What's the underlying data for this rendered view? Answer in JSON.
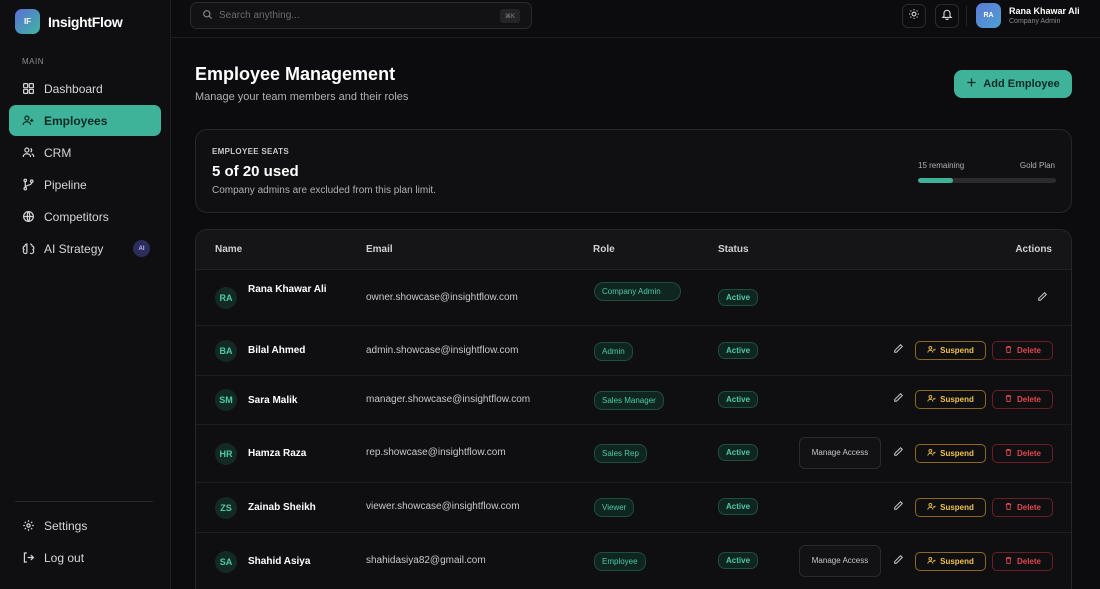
{
  "app": {
    "logo_initials": "IF",
    "name": "InsightFlow"
  },
  "sidebar": {
    "section_label": "MAIN",
    "items": [
      {
        "label": "Dashboard",
        "icon": "grid-icon",
        "active": false
      },
      {
        "label": "Employees",
        "icon": "users-icon",
        "active": true
      },
      {
        "label": "CRM",
        "icon": "people-icon",
        "active": false
      },
      {
        "label": "Pipeline",
        "icon": "branch-icon",
        "active": false
      },
      {
        "label": "Competitors",
        "icon": "globe-icon",
        "active": false
      },
      {
        "label": "AI Strategy",
        "icon": "brain-icon",
        "active": false,
        "badge": "AI"
      }
    ],
    "bottom": [
      {
        "label": "Settings",
        "icon": "gear-icon"
      },
      {
        "label": "Log out",
        "icon": "logout-icon"
      }
    ]
  },
  "topbar": {
    "search_placeholder": "Search anything...",
    "search_shortcut": "⌘K",
    "user": {
      "initials": "RA",
      "name": "Rana Khawar Ali",
      "role": "Company Admin"
    }
  },
  "page": {
    "title": "Employee Management",
    "subtitle": "Manage your team members and their roles",
    "add_button": "Add Employee"
  },
  "seats": {
    "label": "EMPLOYEE SEATS",
    "value": "5 of 20 used",
    "note": "Company admins are excluded from this plan limit.",
    "remaining": "15 remaining",
    "plan": "Gold Plan",
    "used_fraction": 0.25
  },
  "table": {
    "headers": {
      "name": "Name",
      "email": "Email",
      "role": "Role",
      "status": "Status",
      "actions": "Actions"
    },
    "rows": [
      {
        "initials": "RA",
        "name": "Rana Khawar Ali",
        "email": "owner.showcase@insightflow.com",
        "role": "Company Admin",
        "status": "Active"
      },
      {
        "initials": "BA",
        "name": "Bilal Ahmed",
        "email": "admin.showcase@insightflow.com",
        "role": "Admin",
        "status": "Active",
        "suspend": "Suspend",
        "delete": "Delete"
      },
      {
        "initials": "SM",
        "name": "Sara Malik",
        "email": "manager.showcase@insightflow.com",
        "role": "Sales Manager",
        "status": "Active",
        "suspend": "Suspend",
        "delete": "Delete"
      },
      {
        "initials": "HR",
        "name": "Hamza Raza",
        "email": "rep.showcase@insightflow.com",
        "role": "Sales Rep",
        "status": "Active",
        "manage": "Manage Access",
        "suspend": "Suspend",
        "delete": "Delete"
      },
      {
        "initials": "ZS",
        "name": "Zainab Sheikh",
        "email": "viewer.showcase@insightflow.com",
        "role": "Viewer",
        "status": "Active",
        "suspend": "Suspend",
        "delete": "Delete"
      },
      {
        "initials": "SA",
        "name": "Shahid Asiya",
        "email": "shahidasiya82@gmail.com",
        "role": "Employee",
        "status": "Active",
        "manage": "Manage Access",
        "suspend": "Suspend",
        "delete": "Delete"
      }
    ]
  },
  "colors": {
    "accent": "#3fb39a",
    "warning": "#f0c24a",
    "danger": "#e0484e",
    "background": "#0c0c0e"
  }
}
